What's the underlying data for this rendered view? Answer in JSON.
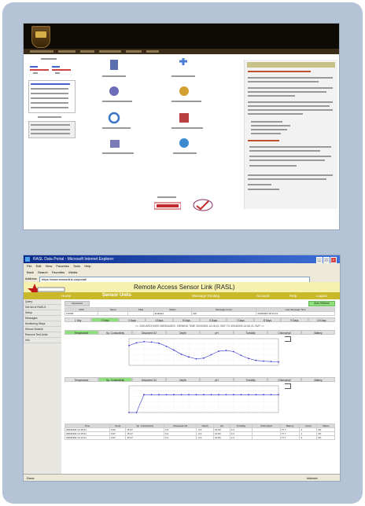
{
  "browser": {
    "title": "RASL Data Portal - Microsoft Internet Explorer",
    "menu": [
      "File",
      "Edit",
      "View",
      "Favorites",
      "Tools",
      "Help"
    ],
    "toolbar": [
      "Back",
      "Search",
      "Favorites",
      "Media"
    ],
    "address_label": "Address",
    "address": "https://www.sensorlink.ca/portal/",
    "status_left": "Done",
    "status_right": "Internet"
  },
  "rasl": {
    "title": "Remote Access Sensor Link (RASL)",
    "nav": [
      "Home",
      "Sensor Units",
      "Message Routing",
      "Account",
      "Help",
      "Logout"
    ],
    "active_nav": "Sensor Units",
    "sidebar": [
      "Query",
      "Get list of RASLS",
      "Setup",
      "Messages",
      "Monitoring Steps",
      "Sensor Module",
      "Remove Test Units",
      "Info"
    ],
    "device_label": "Download",
    "auto_refresh": "Auto Refresh",
    "unit_cols": [
      "ESN",
      "Name",
      "Alias",
      "Status",
      "Message Count",
      "Last Message Time"
    ],
    "unit_row": [
      "0-9283",
      "",
      "",
      "Enabled",
      "120",
      "20040303 18:14:21"
    ],
    "day_tabs": [
      "1 Day",
      "2 Days",
      "3 Days",
      "4 Days",
      "5 Days",
      "6 Days",
      "7 Days",
      "8 Days",
      "9 Days",
      "10 Days"
    ],
    "active_day": "2 Days",
    "viewing": "<< 1000 ARCHIVED MESSAGES, VIEWING TIME 20040303 14:16:21 GMT TO 20040303 14:06:21 GMT >>",
    "param_cols": [
      "Temperature",
      "Sp. Conductivity",
      "Dissolved O2",
      "Depth",
      "pH",
      "Turbidity",
      "Chlorophyll",
      "Battery"
    ],
    "chart1_active": "Temperature",
    "chart2_active": "Sp. Conductivity",
    "legend": "1-9283",
    "data_cols": [
      "Time",
      "Temp",
      "Sp. Conductivity",
      "Dissolved O2",
      "Depth",
      "pH",
      "Turbidity",
      "Chlorophyll",
      "Battery",
      "Count",
      "Status"
    ],
    "data_rows": [
      [
        "20040303 14:16:21",
        "0.00",
        "15.47",
        "6.3",
        "-0.4",
        "10.90",
        "2.3",
        "",
        "77.7",
        "2",
        "OK"
      ],
      [
        "20040303 14:15:21",
        "0.07",
        "15.47",
        "6.4",
        "-0.4",
        "10.90",
        "2.3",
        "",
        "77.7",
        "1",
        "OK"
      ],
      [
        "20040303 14:14:21",
        "0.07",
        "15.47",
        "6.1",
        "-0.4",
        "10.90",
        "2.3",
        "",
        "77.7",
        "2",
        "OK"
      ]
    ]
  },
  "chart_data": [
    {
      "type": "line",
      "x": [
        0,
        1,
        2,
        3,
        4,
        5,
        6,
        7,
        8,
        9,
        10,
        11,
        12,
        13,
        14,
        15,
        16,
        17,
        18,
        19,
        20
      ],
      "values": [
        17.2,
        17.9,
        18.2,
        18.1,
        17.8,
        17.0,
        16.0,
        14.9,
        14.2,
        13.7,
        13.9,
        14.8,
        15.7,
        15.9,
        15.6,
        14.6,
        13.8,
        13.3,
        13.1,
        13.0,
        12.9
      ],
      "ylim": [
        12.0,
        19.0
      ]
    },
    {
      "type": "line",
      "x": [
        0,
        1,
        2,
        3,
        4,
        5,
        6,
        7,
        8,
        9,
        10,
        11,
        12,
        13,
        14,
        15,
        16,
        17,
        18,
        19,
        20
      ],
      "values": [
        0.0,
        0.0,
        0.2,
        0.2,
        0.2,
        0.2,
        0.2,
        0.2,
        0.2,
        0.2,
        0.2,
        0.2,
        0.2,
        0.2,
        0.2,
        0.2,
        0.2,
        0.2,
        0.2,
        0.2,
        0.2
      ],
      "ylim": [
        0.0,
        0.3
      ]
    }
  ],
  "colors": {
    "frame": "#b4c3d6",
    "rasl_nav": "#c8b82a",
    "rasl_header": "#f6f1ae",
    "accent_green": "#8ee07a",
    "line": "#3a3ad0"
  }
}
